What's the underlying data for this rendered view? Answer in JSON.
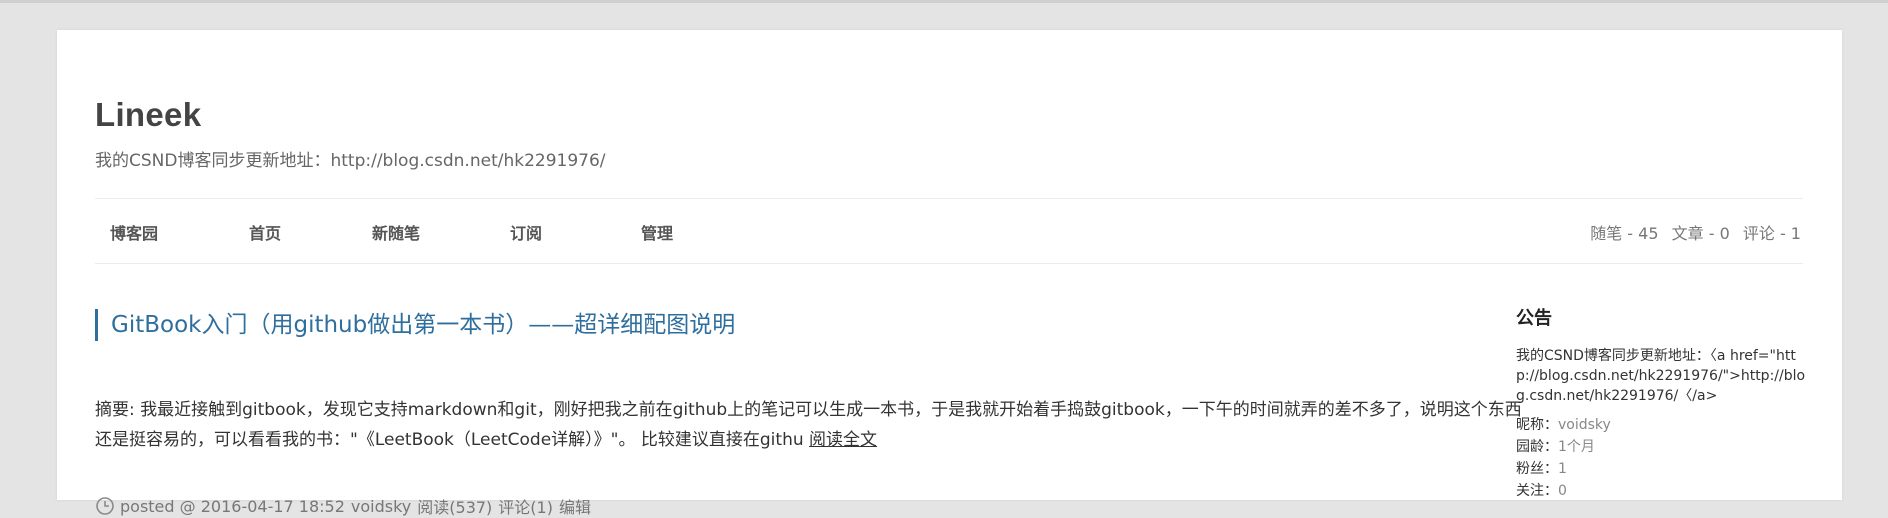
{
  "site": {
    "title": "Lineek",
    "subtitle": "我的CSND博客同步更新地址：http://blog.csdn.net/hk2291976/"
  },
  "nav": {
    "items": [
      "博客园",
      "首页",
      "新随笔",
      "订阅",
      "管理"
    ],
    "stats": {
      "posts": "随笔 - 45",
      "articles": "文章 - 0",
      "comments": "评论 - 1"
    }
  },
  "post": {
    "title": "GitBook入门（用github做出第一本书）——超详细配图说明",
    "summary": "摘要: 我最近接触到gitbook，发现它支持markdown和git，刚好把我之前在github上的笔记可以生成一本书，于是我就开始着手捣鼓gitbook，一下午的时间就弄的差不多了，说明这个东西还是挺容易的，可以看看我的书：\"《LeetBook（LeetCode详解）》\"。 比较建议直接在githu",
    "read_more": "阅读全文",
    "footer": {
      "posted": "posted @ 2016-04-17 18:52",
      "author": "voidsky",
      "reads": "阅读(537)",
      "comments": "评论(1)",
      "edit": "编辑"
    }
  },
  "sidebar": {
    "title": "公告",
    "notice": "我的CSND博客同步更新地址：〈a href=\"http://blog.csdn.net/hk2291976/\">http://blog.csdn.net/hk2291976/〈/a>",
    "nickname_label": "昵称：",
    "nickname": "voidsky",
    "age_label": "园龄：",
    "age": "1个月",
    "fans_label": "粉丝：",
    "fans": "1",
    "follow_label": "关注：",
    "follow": "0"
  }
}
